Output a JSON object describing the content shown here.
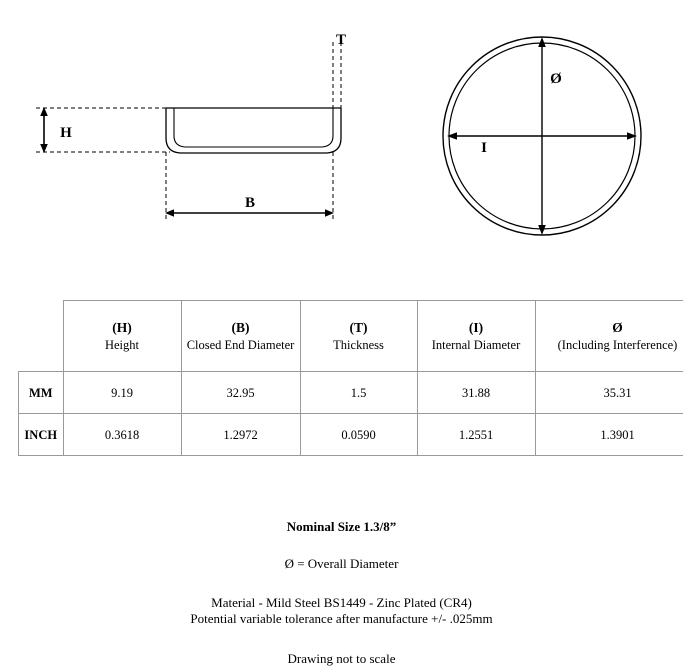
{
  "drawing": {
    "side_view": {
      "name": "Side elevation cross-section of end cap",
      "labels": {
        "height": "H",
        "closed_end_diameter": "B",
        "thickness": "T"
      }
    },
    "plan_view": {
      "name": "Plan view of end cap showing concentric circles",
      "labels": {
        "overall_diameter": "Ø",
        "internal_diameter": "I"
      }
    }
  },
  "table": {
    "corner_blank": "",
    "columns": [
      {
        "code": "(H)",
        "desc": "Height"
      },
      {
        "code": "(B)",
        "desc": "Closed End Diameter"
      },
      {
        "code": "(T)",
        "desc": "Thickness"
      },
      {
        "code": "(I)",
        "desc": "Internal Diameter"
      },
      {
        "code": "Ø",
        "desc": "(Including Interference)"
      }
    ],
    "rows": [
      {
        "unit": "MM",
        "values": [
          "9.19",
          "32.95",
          "1.5",
          "31.88",
          "35.31"
        ]
      },
      {
        "unit": "INCH",
        "values": [
          "0.3618",
          "1.2972",
          "0.0590",
          "1.2551",
          "1.3901"
        ]
      }
    ]
  },
  "notes": {
    "nominal_size": "Nominal Size 1.3/8”",
    "diameter_key": "Ø = Overall Diameter",
    "material": "Material - Mild Steel BS1449 - Zinc Plated (CR4)",
    "tolerance": "Potential variable tolerance after manufacture +/- .025mm",
    "scale": "Drawing not to scale"
  },
  "colors": {
    "line": "#000000",
    "table_border": "#9a9a9a",
    "background": "#ffffff"
  }
}
